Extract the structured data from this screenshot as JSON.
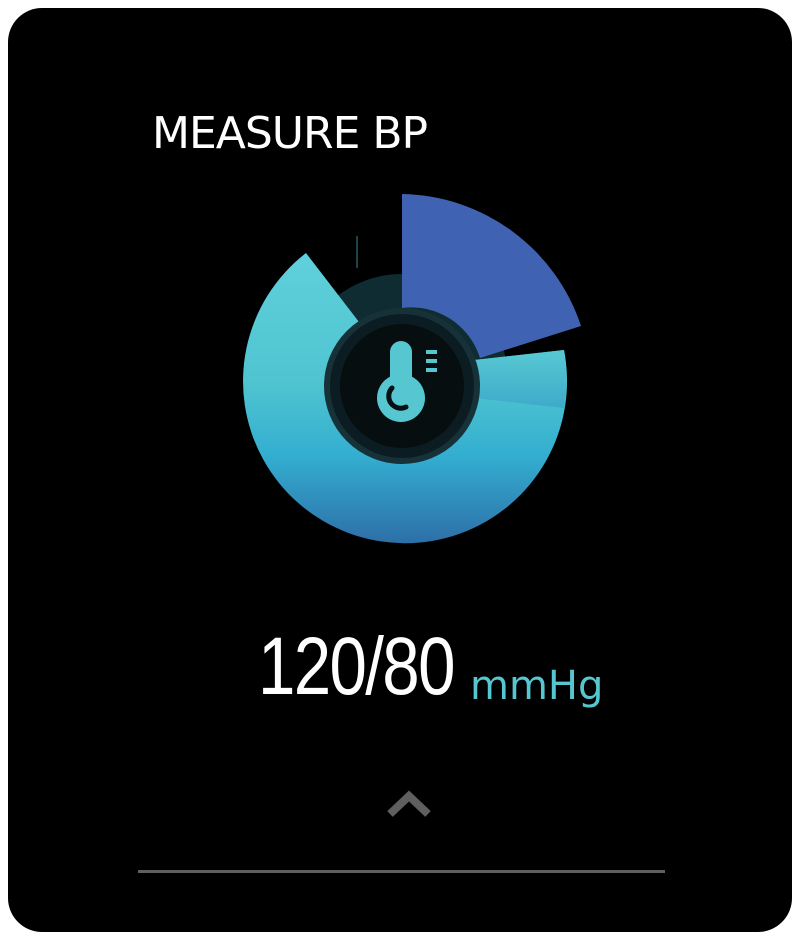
{
  "screen": {
    "title": "MEASURE BP"
  },
  "reading": {
    "value": "120/80",
    "unit": "mmHg"
  },
  "icons": {
    "center": "thermometer-icon",
    "nav": "chevron-up-icon"
  },
  "colors": {
    "background": "#000000",
    "accent_blue": "#3f63b2",
    "accent_teal": "#56c6d0",
    "unit_text": "#56c6d0"
  }
}
